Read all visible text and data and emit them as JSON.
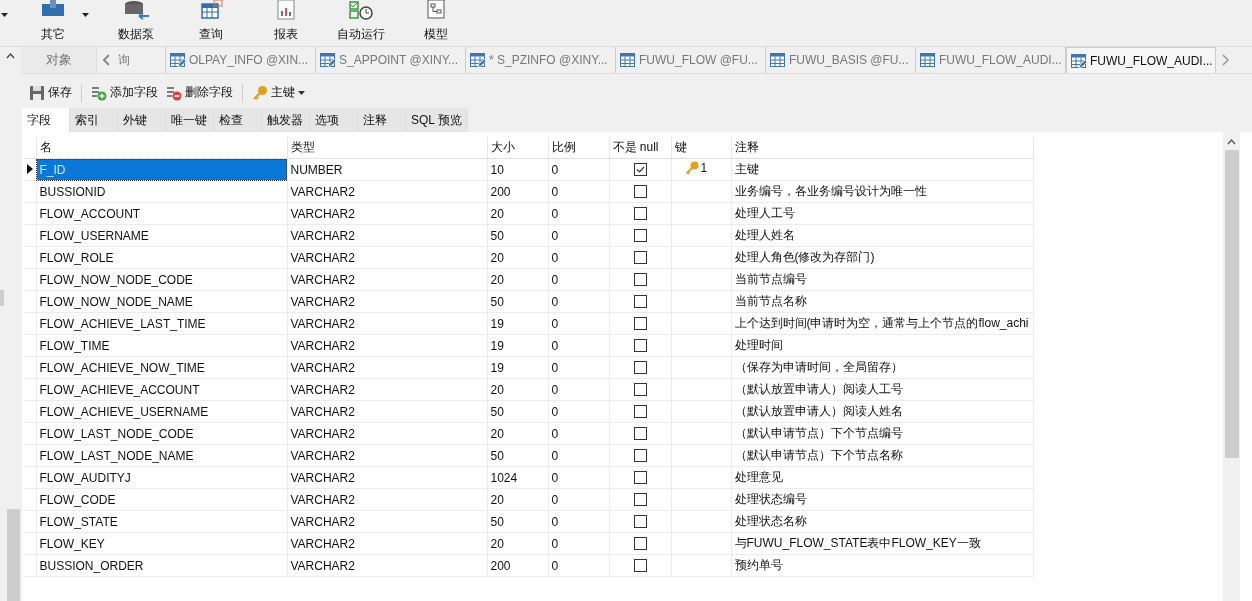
{
  "toolbar": [
    {
      "label": "其它",
      "kind": "other",
      "dropdown": true
    },
    {
      "label": "数据泵",
      "kind": "pump",
      "dropdown": false
    },
    {
      "label": "查询",
      "kind": "query",
      "dropdown": false
    },
    {
      "label": "报表",
      "kind": "report",
      "dropdown": false
    },
    {
      "label": "自动运行",
      "kind": "auto",
      "dropdown": false
    },
    {
      "label": "模型",
      "kind": "model",
      "dropdown": false
    }
  ],
  "object_tab": {
    "label": "对象"
  },
  "tabs": [
    {
      "label": "询",
      "kind": "query",
      "selected": false
    },
    {
      "label": "OLPAY_INFO @XIN...",
      "kind": "design",
      "selected": false
    },
    {
      "label": "S_APPOINT @XINY...",
      "kind": "design",
      "selected": false
    },
    {
      "label": "* S_PZINFO @XINY...",
      "kind": "design",
      "selected": false
    },
    {
      "label": "FUWU_FLOW @FU...",
      "kind": "table",
      "selected": false
    },
    {
      "label": "FUWU_BASIS @FU...",
      "kind": "table",
      "selected": false
    },
    {
      "label": "FUWU_FLOW_AUDI...",
      "kind": "table",
      "selected": false
    },
    {
      "label": "FUWU_FLOW_AUDI...",
      "kind": "design",
      "selected": true
    }
  ],
  "actions": [
    {
      "label": "保存",
      "kind": "save",
      "dropdown": false
    },
    {
      "label": "添加字段",
      "kind": "add",
      "dropdown": false
    },
    {
      "label": "删除字段",
      "kind": "delete",
      "dropdown": false
    },
    {
      "label": "主键",
      "kind": "key",
      "dropdown": true
    }
  ],
  "subtabs": [
    {
      "label": "字段",
      "selected": true
    },
    {
      "label": "索引",
      "selected": false
    },
    {
      "label": "外键",
      "selected": false
    },
    {
      "label": "唯一键",
      "selected": false
    },
    {
      "label": "检查",
      "selected": false
    },
    {
      "label": "触发器",
      "selected": false
    },
    {
      "label": "选项",
      "selected": false
    },
    {
      "label": "注释",
      "selected": false
    },
    {
      "label": "SQL 预览",
      "selected": false
    }
  ],
  "table": {
    "columns": [
      "名",
      "类型",
      "大小",
      "比例",
      "不是 null",
      "键",
      "注释"
    ],
    "rows": [
      {
        "name": "F_ID",
        "type": "NUMBER",
        "size": "10",
        "scale": "0",
        "not_null": true,
        "key": "1",
        "comment": "主键",
        "selected": true
      },
      {
        "name": "BUSSIONID",
        "type": "VARCHAR2",
        "size": "200",
        "scale": "0",
        "not_null": false,
        "comment": "业务编号，各业务编号设计为唯一性",
        "selected": false
      },
      {
        "name": "FLOW_ACCOUNT",
        "type": "VARCHAR2",
        "size": "20",
        "scale": "0",
        "not_null": false,
        "comment": "处理人工号",
        "selected": false
      },
      {
        "name": "FLOW_USERNAME",
        "type": "VARCHAR2",
        "size": "50",
        "scale": "0",
        "not_null": false,
        "comment": "处理人姓名",
        "selected": false
      },
      {
        "name": "FLOW_ROLE",
        "type": "VARCHAR2",
        "size": "20",
        "scale": "0",
        "not_null": false,
        "comment": "处理人角色(修改为存部门)",
        "selected": false
      },
      {
        "name": "FLOW_NOW_NODE_CODE",
        "type": "VARCHAR2",
        "size": "20",
        "scale": "0",
        "not_null": false,
        "comment": "当前节点编号",
        "selected": false
      },
      {
        "name": "FLOW_NOW_NODE_NAME",
        "type": "VARCHAR2",
        "size": "50",
        "scale": "0",
        "not_null": false,
        "comment": "当前节点名称",
        "selected": false
      },
      {
        "name": "FLOW_ACHIEVE_LAST_TIME",
        "type": "VARCHAR2",
        "size": "19",
        "scale": "0",
        "not_null": false,
        "comment": "上个达到时间(申请时为空，通常与上个节点的flow_achi",
        "selected": false
      },
      {
        "name": "FLOW_TIME",
        "type": "VARCHAR2",
        "size": "19",
        "scale": "0",
        "not_null": false,
        "comment": "处理时间",
        "selected": false
      },
      {
        "name": "FLOW_ACHIEVE_NOW_TIME",
        "type": "VARCHAR2",
        "size": "19",
        "scale": "0",
        "not_null": false,
        "comment": "（保存为申请时间，全局留存）",
        "selected": false
      },
      {
        "name": "FLOW_ACHIEVE_ACCOUNT",
        "type": "VARCHAR2",
        "size": "20",
        "scale": "0",
        "not_null": false,
        "comment": "（默认放置申请人）阅读人工号",
        "selected": false
      },
      {
        "name": "FLOW_ACHIEVE_USERNAME",
        "type": "VARCHAR2",
        "size": "50",
        "scale": "0",
        "not_null": false,
        "comment": "（默认放置申请人）阅读人姓名",
        "selected": false
      },
      {
        "name": "FLOW_LAST_NODE_CODE",
        "type": "VARCHAR2",
        "size": "20",
        "scale": "0",
        "not_null": false,
        "comment": "（默认申请节点）下个节点编号",
        "selected": false
      },
      {
        "name": "FLOW_LAST_NODE_NAME",
        "type": "VARCHAR2",
        "size": "50",
        "scale": "0",
        "not_null": false,
        "comment": "（默认申请节点）下个节点名称",
        "selected": false
      },
      {
        "name": "FLOW_AUDITYJ",
        "type": "VARCHAR2",
        "size": "1024",
        "scale": "0",
        "not_null": false,
        "comment": "处理意见",
        "selected": false
      },
      {
        "name": "FLOW_CODE",
        "type": "VARCHAR2",
        "size": "20",
        "scale": "0",
        "not_null": false,
        "comment": "处理状态编号",
        "selected": false
      },
      {
        "name": "FLOW_STATE",
        "type": "VARCHAR2",
        "size": "50",
        "scale": "0",
        "not_null": false,
        "comment": "处理状态名称",
        "selected": false
      },
      {
        "name": "FLOW_KEY",
        "type": "VARCHAR2",
        "size": "20",
        "scale": "0",
        "not_null": false,
        "comment": "与FUWU_FLOW_STATE表中FLOW_KEY一致",
        "selected": false
      },
      {
        "name": "BUSSION_ORDER",
        "type": "VARCHAR2",
        "size": "200",
        "scale": "0",
        "not_null": false,
        "comment": "预约单号",
        "selected": false
      }
    ]
  }
}
